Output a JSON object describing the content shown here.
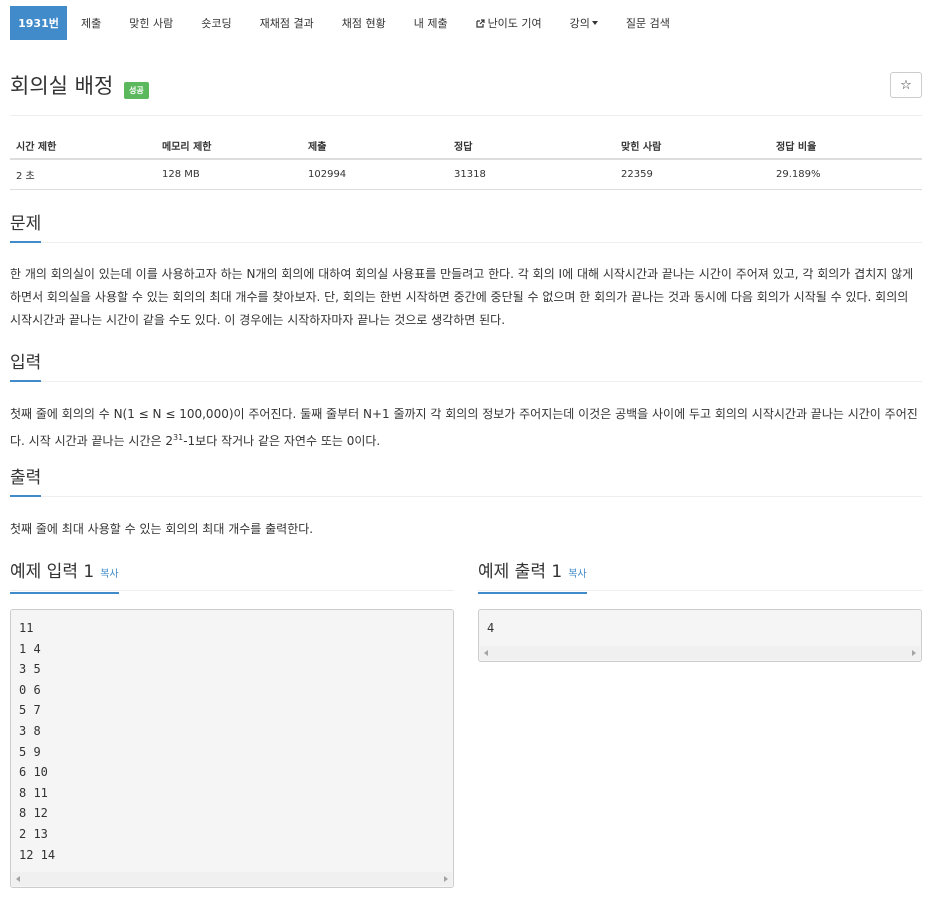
{
  "tabs": [
    {
      "label": "1931번"
    },
    {
      "label": "제출"
    },
    {
      "label": "맞힌 사람"
    },
    {
      "label": "숏코딩"
    },
    {
      "label": "재채점 결과"
    },
    {
      "label": "채점 현황"
    },
    {
      "label": "내 제출"
    },
    {
      "label": "난이도 기여",
      "icon": "external-link-icon"
    },
    {
      "label": "강의",
      "icon": "caret-down-icon"
    },
    {
      "label": "질문 검색"
    }
  ],
  "problem": {
    "title": "회의실 배정",
    "badge": "성공",
    "star_icon": "star-icon"
  },
  "info_table": {
    "headers": [
      "시간 제한",
      "메모리 제한",
      "제출",
      "정답",
      "맞힌 사람",
      "정답 비율"
    ],
    "values": [
      "2 초",
      "128 MB",
      "102994",
      "31318",
      "22359",
      "29.189%"
    ]
  },
  "sections": {
    "problem_title": "문제",
    "problem_text": "한 개의 회의실이 있는데 이를 사용하고자 하는 N개의 회의에 대하여 회의실 사용표를 만들려고 한다. 각 회의 I에 대해 시작시간과 끝나는 시간이 주어져 있고, 각 회의가 겹치지 않게 하면서 회의실을 사용할 수 있는 회의의 최대 개수를 찾아보자. 단, 회의는 한번 시작하면 중간에 중단될 수 없으며 한 회의가 끝나는 것과 동시에 다음 회의가 시작될 수 있다. 회의의 시작시간과 끝나는 시간이 같을 수도 있다. 이 경우에는 시작하자마자 끝나는 것으로 생각하면 된다.",
    "input_title": "입력",
    "input_text_1": "첫째 줄에 회의의 수 N(1 ≤ N ≤ 100,000)이 주어진다. 둘째 줄부터 N+1 줄까지 각 회의의 정보가 주어지는데 이것은 공백을 사이에 두고 회의의 시작시간과 끝나는 시간이 주어진다. 시작 시간과 끝나는 시간은 2",
    "input_sup": "31",
    "input_text_2": "-1보다 작거나 같은 자연수 또는 0이다.",
    "output_title": "출력",
    "output_text": "첫째 줄에 최대 사용할 수 있는 회의의 최대 개수를 출력한다."
  },
  "samples": {
    "input_title": "예제 입력 1",
    "output_title": "예제 출력 1",
    "copy_label": "복사",
    "input_lines": "11\n1 4\n3 5\n0 6\n5 7\n3 8\n5 9\n6 10\n8 11\n8 12\n2 13\n12 14",
    "output_lines": "4"
  }
}
